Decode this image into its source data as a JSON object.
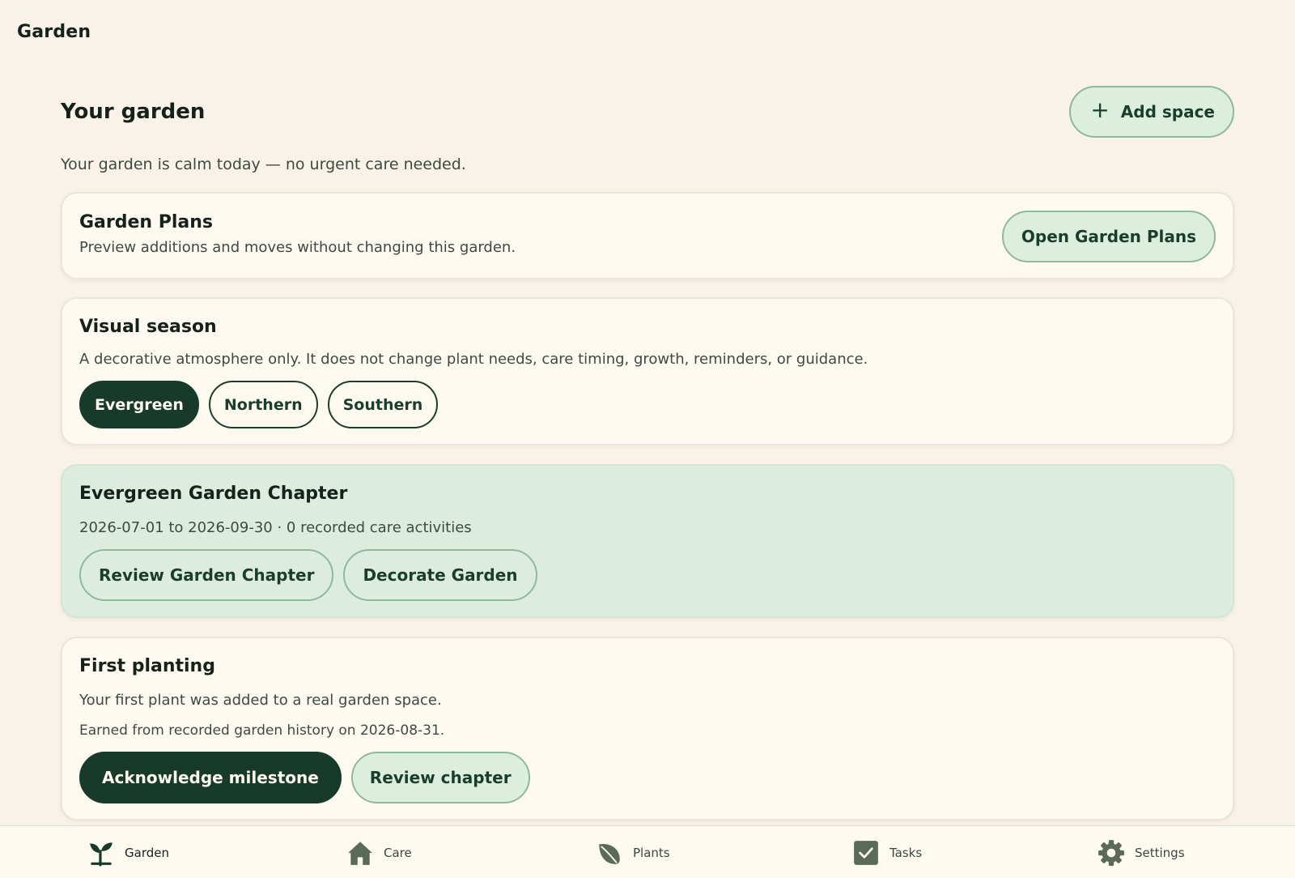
{
  "app": {
    "title": "Garden"
  },
  "header": {
    "title": "Your garden",
    "add_label": "Add space",
    "add_icon": "plus-icon"
  },
  "status": {
    "text": "Your garden is calm today — no urgent care needed."
  },
  "plans": {
    "title": "Garden Plans",
    "description": "Preview additions and moves without changing this garden.",
    "button": "Open Garden Plans"
  },
  "season": {
    "title": "Visual season",
    "description": "A decorative atmosphere only. It does not change plant needs, care timing, growth, reminders, or guidance.",
    "options": [
      "Evergreen",
      "Northern",
      "Southern"
    ],
    "selected": "Evergreen"
  },
  "chapter": {
    "title": "Evergreen Garden Chapter",
    "meta": "2026-07-01 to 2026-09-30 · 0 recorded care activities",
    "review_label": "Review Garden Chapter",
    "decorate_label": "Decorate Garden"
  },
  "milestone": {
    "title": "First planting",
    "description": "Your first plant was added to a real garden space.",
    "earned": "Earned from recorded garden history on 2026-08-31.",
    "ack_label": "Acknowledge milestone",
    "review_label": "Review chapter"
  },
  "tabs": [
    {
      "label": "Garden",
      "icon": "sprout-icon",
      "active": true
    },
    {
      "label": "Care",
      "icon": "house-icon",
      "active": false
    },
    {
      "label": "Plants",
      "icon": "leaf-icon",
      "active": false
    },
    {
      "label": "Tasks",
      "icon": "checkbox-icon",
      "active": false
    },
    {
      "label": "Settings",
      "icon": "gear-icon",
      "active": false
    }
  ],
  "colors": {
    "background": "#f8f2e8",
    "card": "#fefaf1",
    "accent_dark": "#173a2b",
    "accent_soft": "#dceede",
    "chapter_bg": "#dcede0"
  }
}
